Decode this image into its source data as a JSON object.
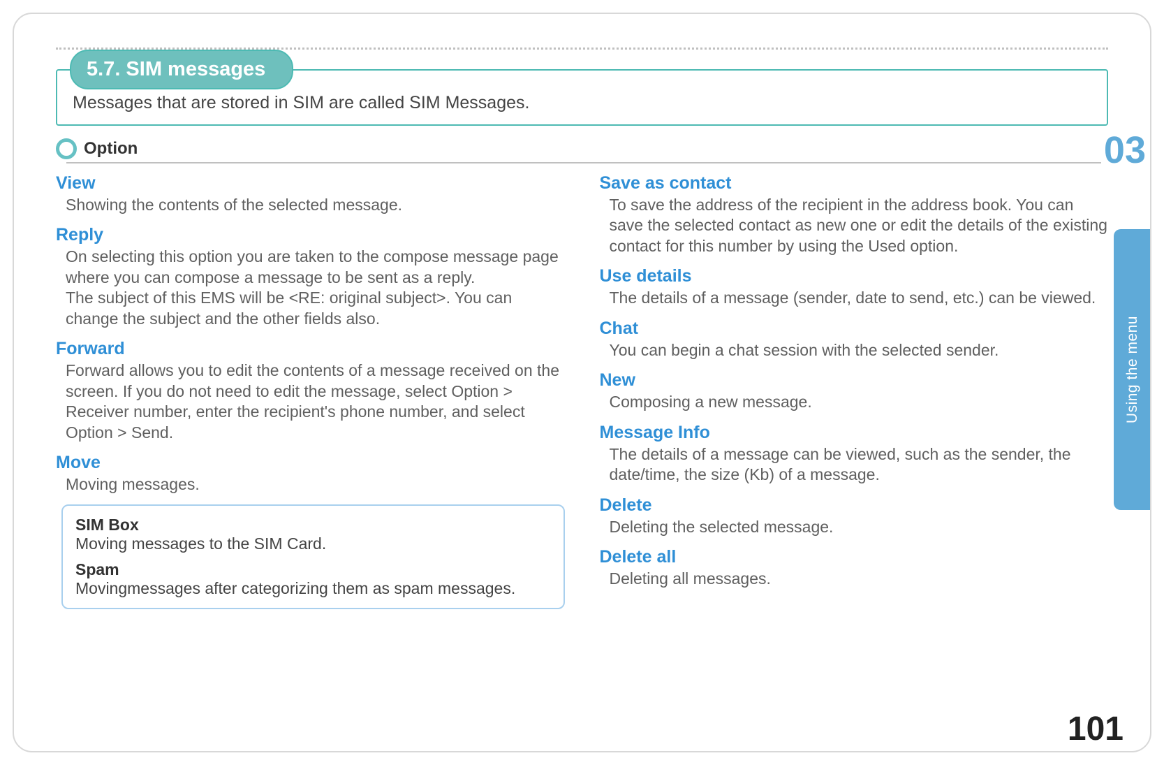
{
  "section": {
    "number_title": "5.7. SIM messages",
    "intro": "Messages that are stored in SIM are called SIM Messages."
  },
  "option_label": "Option",
  "left": {
    "view": {
      "title": "View",
      "body": "Showing the contents of the selected message."
    },
    "reply": {
      "title": "Reply",
      "body": "On selecting this option you are taken to the compose message page where you can compose a message to be sent as a reply.\nThe subject of this EMS will be <RE: original subject>. You can change the subject and the other fields also."
    },
    "forward": {
      "title": "Forward",
      "body": "Forward allows you to edit the contents of a message received on the screen. If you do not need to edit the message, select Option > Receiver number, enter the recipient's phone number, and select Option > Send."
    },
    "move": {
      "title": "Move",
      "body": "Moving messages."
    },
    "sub": {
      "simbox_title": "SIM Box",
      "simbox_body": "Moving messages to the SIM Card.",
      "spam_title": "Spam",
      "spam_body": "Movingmessages after categorizing them as spam messages."
    }
  },
  "right": {
    "save_contact": {
      "title": "Save as contact",
      "body": "To save the address of the recipient in the address book. You can save the selected contact as new one or edit the details of the existing contact for this number by using the Used option."
    },
    "use_details": {
      "title": "Use details",
      "body": "The details of a message (sender, date to send, etc.) can be viewed."
    },
    "chat": {
      "title": "Chat",
      "body": "You can begin a chat session with the selected sender."
    },
    "new": {
      "title": "New",
      "body": "Composing a new message."
    },
    "msg_info": {
      "title": "Message Info",
      "body": "The details of a message can be viewed, such as the sender, the date/time, the size (Kb) of a message."
    },
    "delete": {
      "title": "Delete",
      "body": "Deleting the selected message."
    },
    "delete_all": {
      "title": "Delete all",
      "body": "Deleting all messages."
    }
  },
  "side_tab": "Using the menu",
  "chapter": "03",
  "page_number": "101"
}
